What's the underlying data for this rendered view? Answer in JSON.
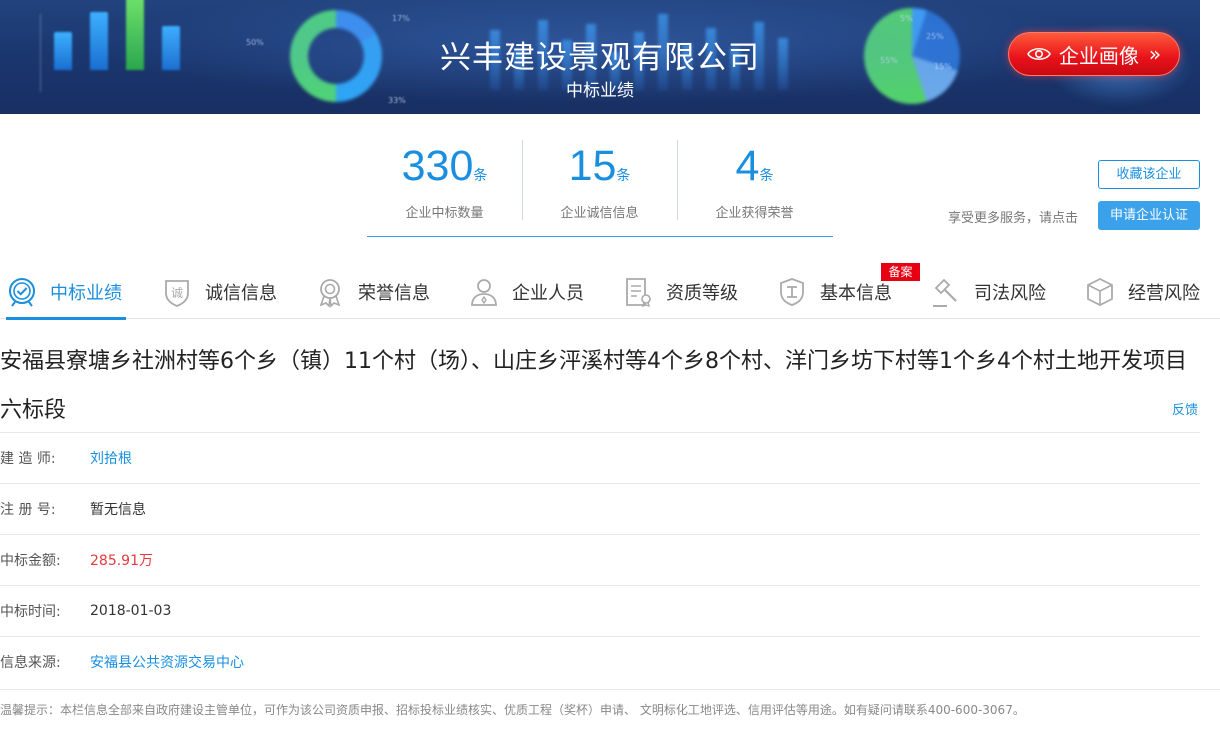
{
  "banner": {
    "company_name": "兴丰建设景观有限公司",
    "subtitle": "中标业绩",
    "portrait_button": "企业画像",
    "deco": {
      "ring_a": "50%",
      "ring_b": "17%",
      "ring_c": "33%",
      "pie_a": "5%",
      "pie_b": "25%",
      "pie_c": "55%",
      "pie_d": "15%"
    }
  },
  "stats": [
    {
      "value": "330",
      "unit": "条",
      "label": "企业中标数量"
    },
    {
      "value": "15",
      "unit": "条",
      "label": "企业诚信信息"
    },
    {
      "value": "4",
      "unit": "条",
      "label": "企业获得荣誉"
    }
  ],
  "actions": {
    "favorite": "收藏该企业",
    "more_services": "享受更多服务，请点击",
    "apply": "申请企业认证"
  },
  "tabs": [
    {
      "label": "中标业绩",
      "icon": "check-circle-icon"
    },
    {
      "label": "诚信信息",
      "icon": "shield-cheng-icon"
    },
    {
      "label": "荣誉信息",
      "icon": "medal-icon"
    },
    {
      "label": "企业人员",
      "icon": "person-icon"
    },
    {
      "label": "资质等级",
      "icon": "certificate-icon"
    },
    {
      "label": "基本信息",
      "icon": "shield-gong-icon"
    },
    {
      "label": "司法风险",
      "icon": "gavel-icon"
    },
    {
      "label": "经营风险",
      "icon": "cube-icon"
    }
  ],
  "tab_badge": "备案",
  "active_tab_color": "#1a8fe0",
  "project": {
    "title": "安福县寮塘乡社洲村等6个乡（镇）11个村（场）、山庄乡泙溪村等4个乡8个村、洋门乡坊下村等1个乡4个村土地开发项目六标段",
    "feedback": "反馈",
    "fields": [
      {
        "key": "建 造 师:",
        "value": "刘拾根"
      },
      {
        "key": "注 册 号:",
        "value": "暂无信息"
      },
      {
        "key": "中标金额:",
        "value": "285.91万"
      },
      {
        "key": "中标时间:",
        "value": "2018-01-03"
      },
      {
        "key": "信息来源:",
        "value": "安福县公共资源交易中心"
      }
    ]
  },
  "notice": "温馨提示：本栏信息全部来自政府建设主管单位，可作为该公司资质申报、招标投标业绩核实、优质工程（奖杯）申请、 文明标化工地评选、信用评估等用途。如有疑问请联系400-600-3067。"
}
